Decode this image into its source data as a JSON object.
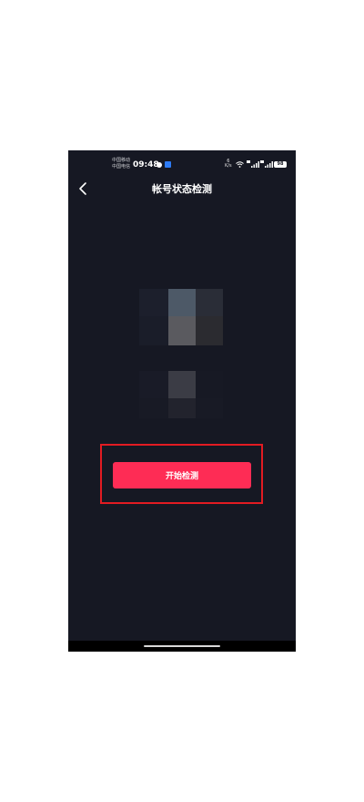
{
  "status_bar": {
    "carrier_1": "中国移动",
    "carrier_2": "中国电信",
    "time": "09:48",
    "speed_value": "6",
    "speed_unit": "K/s",
    "battery": "98",
    "icons": [
      "notification-dot-icon",
      "app-notification-icon",
      "wifi-icon",
      "cell-signal-icon",
      "cell-signal-icon",
      "battery-icon"
    ]
  },
  "header": {
    "title": "帐号状态检测",
    "back_icon": "chevron-left-icon"
  },
  "main": {
    "start_button_label": "开始检测"
  },
  "colors": {
    "background": "#161823",
    "accent": "#fe2c55",
    "highlight": "#e21b22"
  }
}
